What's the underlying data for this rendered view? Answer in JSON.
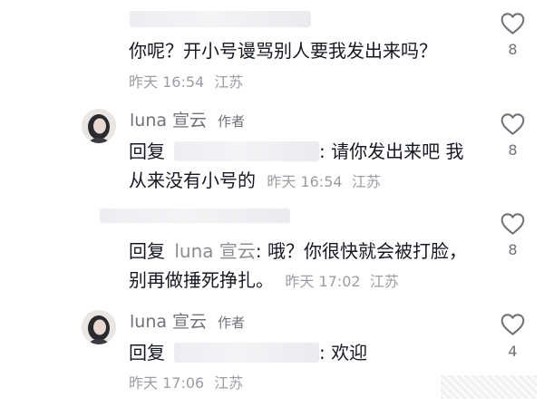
{
  "comments": [
    {
      "text": "你呢？开小号谩骂别人要我发出来吗？",
      "time": "昨天 16:54",
      "location": "江苏",
      "likes": "8"
    },
    {
      "username": "luna 宣云",
      "author_tag": "作者",
      "reply_prefix": "回复",
      "text_line1": ": 请你发出来吧 我",
      "text_line2": "从来没有小号的",
      "time": "昨天 16:54",
      "location": "江苏",
      "likes": "8"
    },
    {
      "reply_prefix": "回复",
      "reply_target": "luna 宣云",
      "text_line1": ": 哦？你很快就会被打脸，",
      "text_line2": "别再做捶死挣扎。",
      "time": "昨天 17:02",
      "location": "江苏",
      "likes": "8"
    },
    {
      "username": "luna 宣云",
      "author_tag": "作者",
      "reply_prefix": "回复",
      "text_line1": ": 欢迎",
      "time": "昨天 17:06",
      "location": "江苏",
      "likes": "4"
    }
  ],
  "icons": {
    "like": "heart-outline-icon",
    "avatar": "user-avatar"
  }
}
